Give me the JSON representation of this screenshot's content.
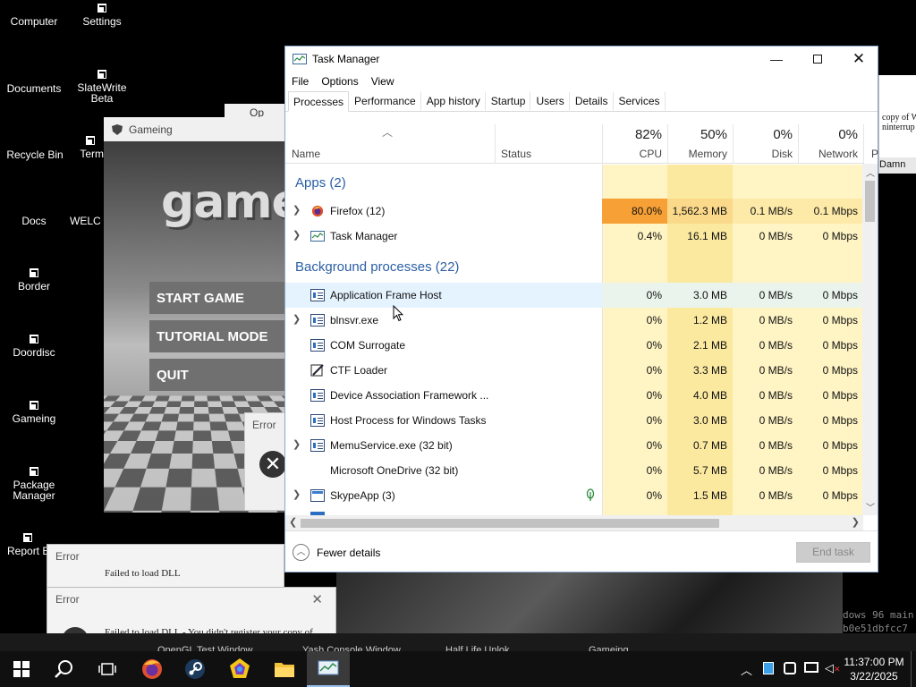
{
  "desktop": {
    "icons": [
      {
        "label": "Computer"
      },
      {
        "label": "Settings"
      },
      {
        "label": "Documents"
      },
      {
        "label": "SlateWrite Beta"
      },
      {
        "label": "Recycle Bin"
      },
      {
        "label": "Term"
      },
      {
        "label": "Docs"
      },
      {
        "label": "WELC"
      },
      {
        "label": "Border"
      },
      {
        "label": "Doordisc"
      },
      {
        "label": "Gameing"
      },
      {
        "label": "Package Manager"
      },
      {
        "label": "Report B"
      }
    ],
    "partial_window_label": "Op",
    "background_text": {
      "copy_line_1": "copy of W",
      "copy_line_2": "ninterrup",
      "damn": "Damn",
      "console_1": "dows 96 main",
      "console_2": "b0e51dbfcc7"
    }
  },
  "game_window": {
    "title": "Gameing",
    "logo_text": "gamei",
    "buttons": [
      "START GAME",
      "TUTORIAL MODE",
      "QUIT"
    ],
    "error_title": "Error"
  },
  "error_dialogs": [
    {
      "title": "Error",
      "message": "Failed to load DLL"
    },
    {
      "title": "Error",
      "message": "Failed to load DLL - You didn't register your copy of"
    }
  ],
  "task_manager": {
    "title": "Task Manager",
    "menu": [
      "File",
      "Options",
      "View"
    ],
    "tabs": [
      "Processes",
      "Performance",
      "App history",
      "Startup",
      "Users",
      "Details",
      "Services"
    ],
    "columns": {
      "name": "Name",
      "status": "Status",
      "cpu": {
        "pct": "82%",
        "label": "CPU"
      },
      "memory": {
        "pct": "50%",
        "label": "Memory"
      },
      "disk": {
        "pct": "0%",
        "label": "Disk"
      },
      "network": {
        "pct": "0%",
        "label": "Network"
      },
      "power": "P"
    },
    "groups": {
      "apps": "Apps (2)",
      "background": "Background processes (22)"
    },
    "apps": [
      {
        "name": "Firefox (12)",
        "cpu": "80.0%",
        "memory": "1,562.3 MB",
        "disk": "0.1 MB/s",
        "network": "0.1 Mbps"
      },
      {
        "name": "Task Manager",
        "cpu": "0.4%",
        "memory": "16.1 MB",
        "disk": "0 MB/s",
        "network": "0 Mbps"
      }
    ],
    "background": [
      {
        "name": "Application Frame Host",
        "cpu": "0%",
        "memory": "3.0 MB",
        "disk": "0 MB/s",
        "network": "0 Mbps"
      },
      {
        "name": "blnsvr.exe",
        "cpu": "0%",
        "memory": "1.2 MB",
        "disk": "0 MB/s",
        "network": "0 Mbps"
      },
      {
        "name": "COM Surrogate",
        "cpu": "0%",
        "memory": "2.1 MB",
        "disk": "0 MB/s",
        "network": "0 Mbps"
      },
      {
        "name": "CTF Loader",
        "cpu": "0%",
        "memory": "3.3 MB",
        "disk": "0 MB/s",
        "network": "0 Mbps"
      },
      {
        "name": "Device Association Framework ...",
        "cpu": "0%",
        "memory": "4.0 MB",
        "disk": "0 MB/s",
        "network": "0 Mbps"
      },
      {
        "name": "Host Process for Windows Tasks",
        "cpu": "0%",
        "memory": "3.0 MB",
        "disk": "0 MB/s",
        "network": "0 Mbps"
      },
      {
        "name": "MemuService.exe (32 bit)",
        "cpu": "0%",
        "memory": "0.7 MB",
        "disk": "0 MB/s",
        "network": "0 Mbps"
      },
      {
        "name": "Microsoft OneDrive (32 bit)",
        "cpu": "0%",
        "memory": "5.7 MB",
        "disk": "0 MB/s",
        "network": "0 Mbps"
      },
      {
        "name": "SkypeApp (3)",
        "cpu": "0%",
        "memory": "1.5 MB",
        "disk": "0 MB/s",
        "network": "0 Mbps"
      }
    ],
    "footer": {
      "fewer_details": "Fewer details",
      "end_task": "End task"
    },
    "colors": {
      "cpu_hot": "#f7a035",
      "heat_light": "#fff4c4",
      "heat_mid": "#fbe9a0",
      "selected": "#e5f3ff"
    }
  },
  "background_taskbar_items": [
    "OpenGL Test Window",
    "Yash Console Window",
    "Half Life Unlok",
    "Gameing"
  ],
  "taskbar": {
    "time": "11:37:00 PM",
    "date": "3/22/2025",
    "pinned": [
      "windows-start-icon",
      "search-icon",
      "task-view-icon",
      "firefox-icon",
      "steam-icon",
      "app-icon",
      "file-explorer-icon",
      "task-manager-icon"
    ]
  }
}
